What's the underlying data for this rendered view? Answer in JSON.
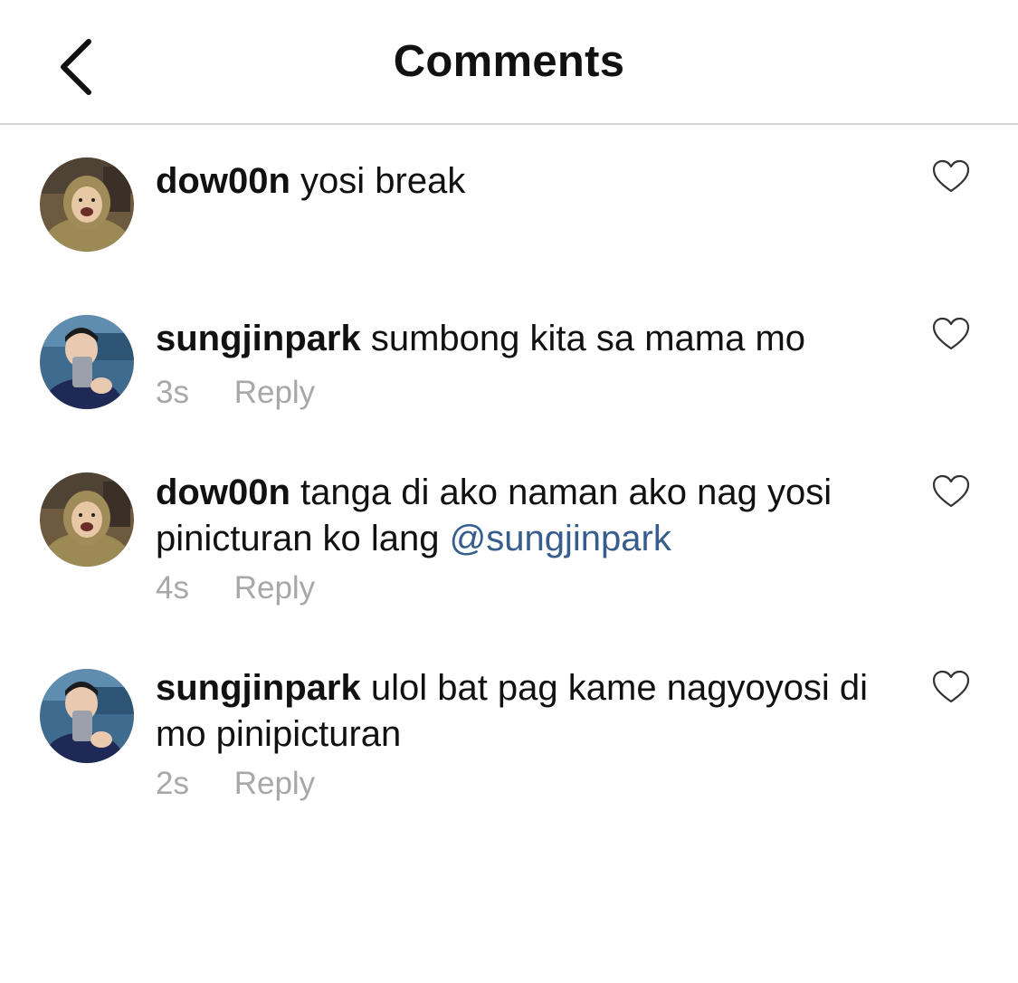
{
  "header": {
    "title": "Comments"
  },
  "comments": [
    {
      "username": "dow00n",
      "text": "yosi break",
      "mention": "",
      "time": "",
      "reply_label": "",
      "avatar_icon": "user-avatar-hoodie"
    },
    {
      "username": "sungjinpark",
      "text": "sumbong kita sa mama mo",
      "mention": "",
      "time": "3s",
      "reply_label": "Reply",
      "avatar_icon": "user-avatar-mirror-selfie"
    },
    {
      "username": "dow00n",
      "text": "tanga di ako naman ako nag yosi pinicturan ko lang",
      "mention": "@sungjinpark",
      "time": "4s",
      "reply_label": "Reply",
      "avatar_icon": "user-avatar-hoodie"
    },
    {
      "username": "sungjinpark",
      "text": "ulol bat pag kame nagyoyosi di mo pinipicturan",
      "mention": "",
      "time": "2s",
      "reply_label": "Reply",
      "avatar_icon": "user-avatar-mirror-selfie"
    }
  ],
  "colors": {
    "mention": "#365d8c",
    "meta": "#a8a8a8",
    "divider": "#d6d6d6"
  }
}
